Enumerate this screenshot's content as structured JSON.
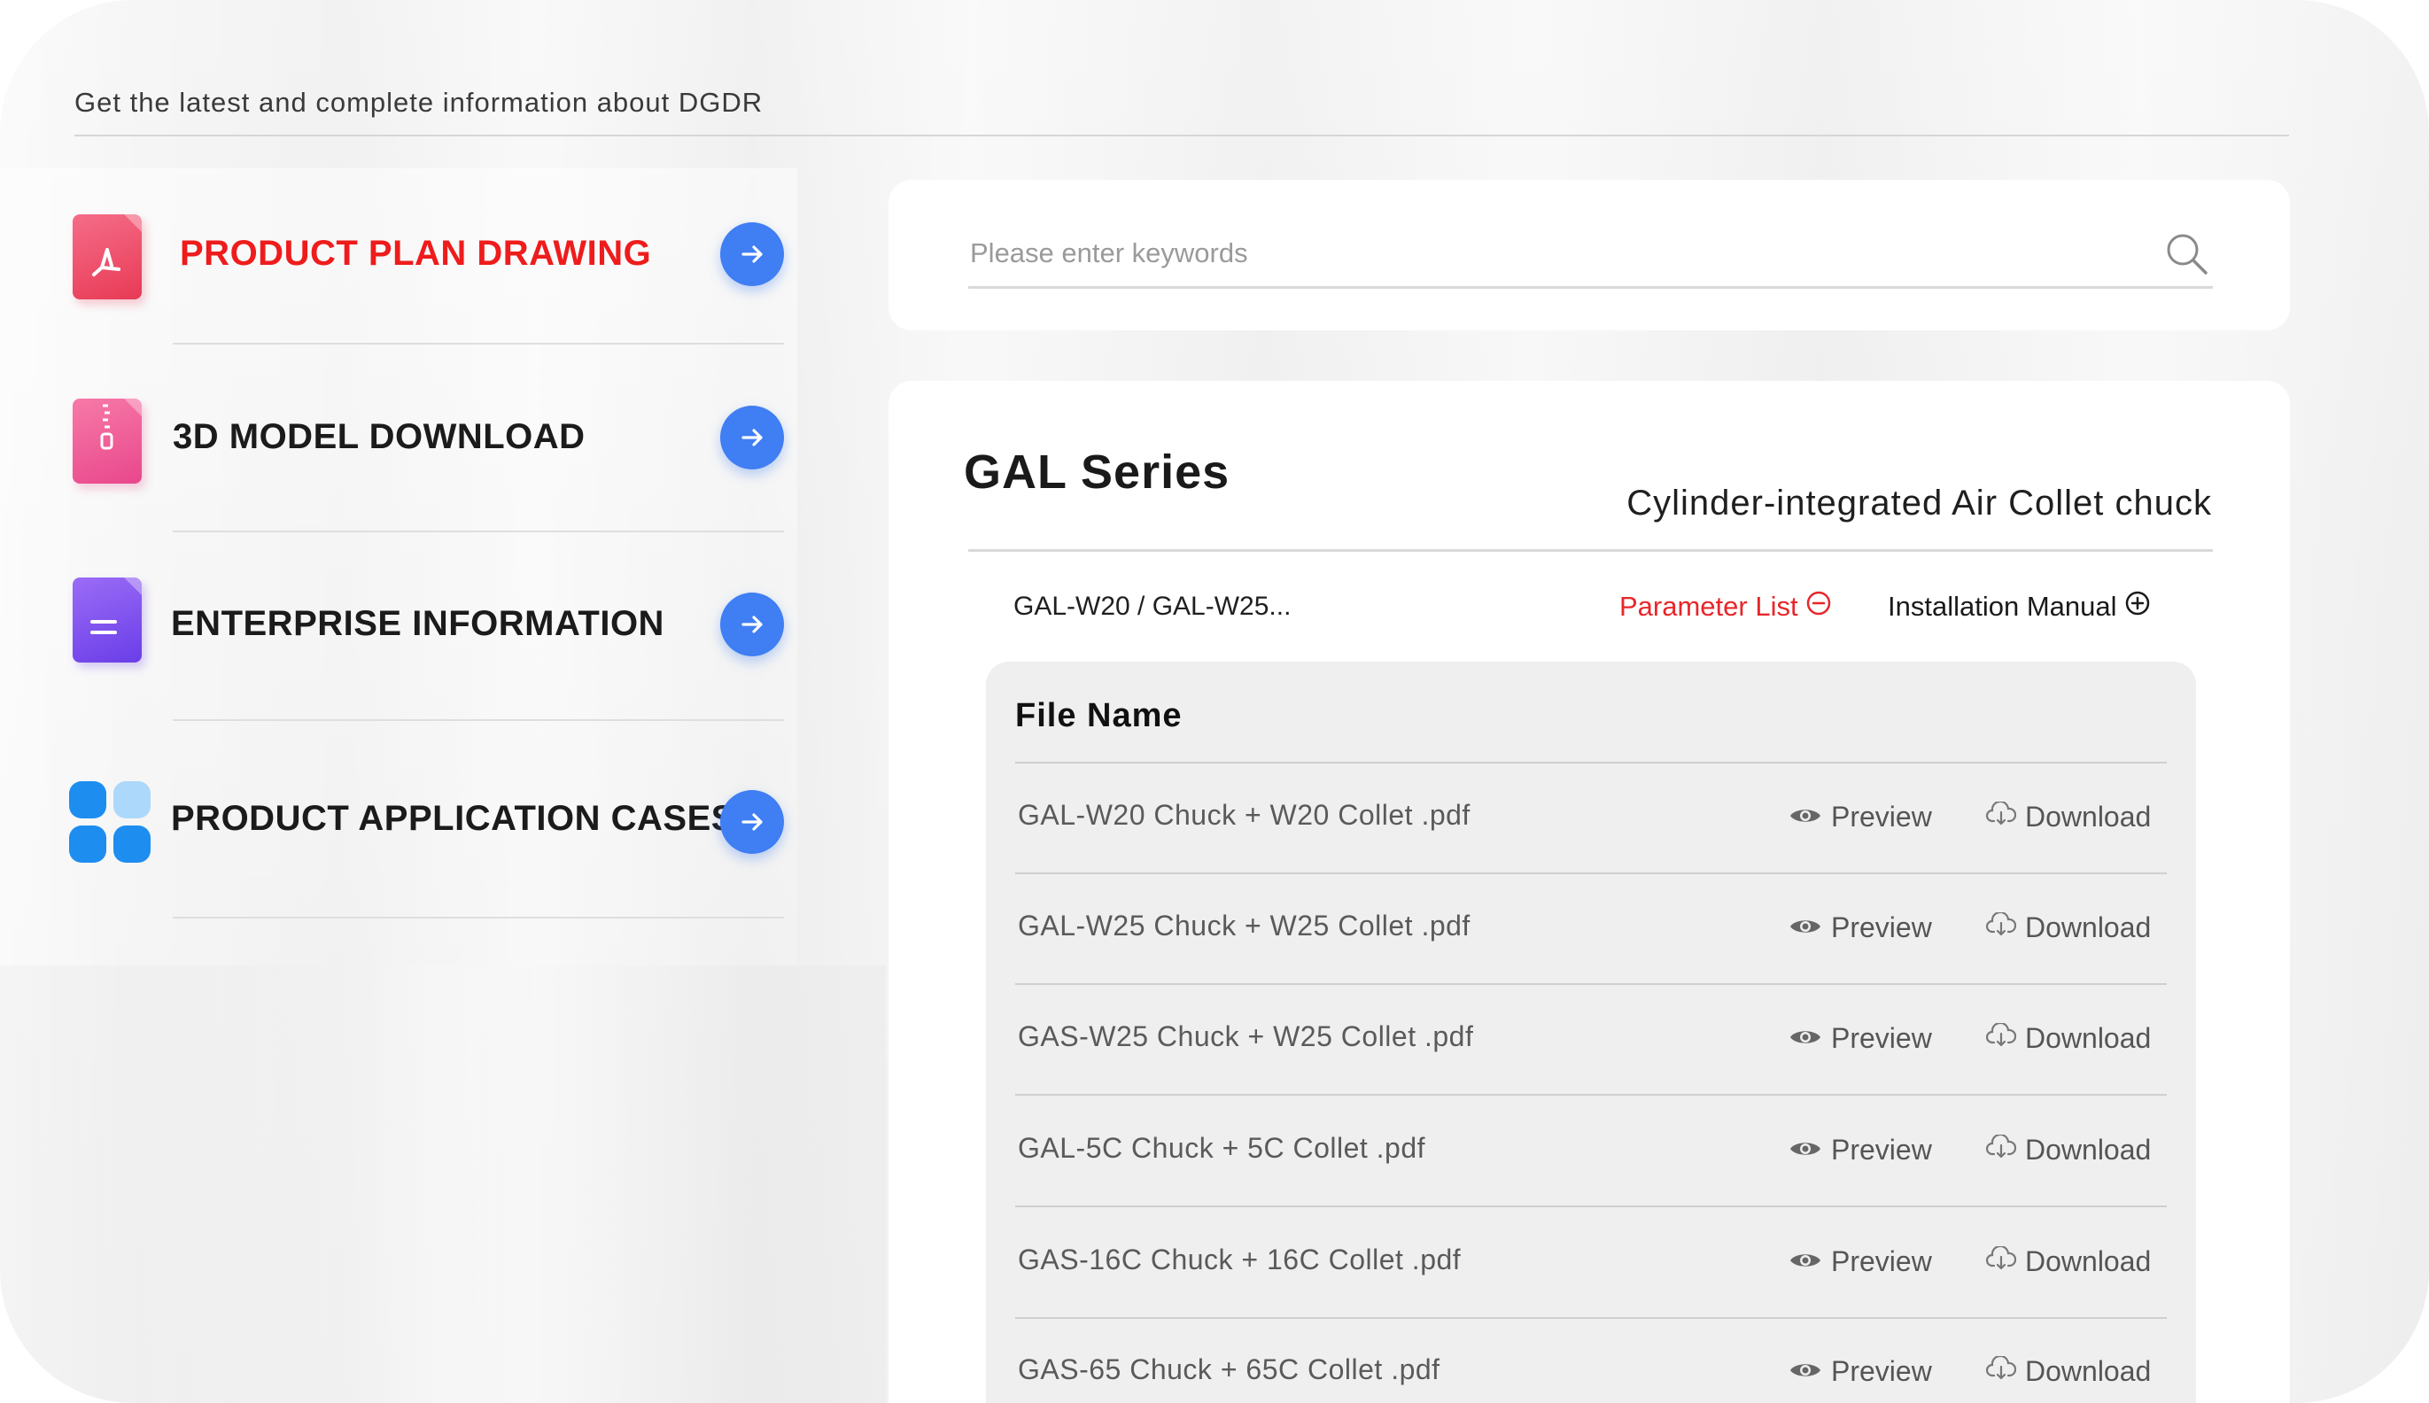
{
  "header": {
    "tagline": "Get the latest and complete information about DGDR"
  },
  "sidebar": {
    "items": [
      {
        "label": "PRODUCT PLAN DRAWING",
        "icon": "pdf-icon",
        "active": true
      },
      {
        "label": "3D MODEL DOWNLOAD",
        "icon": "zip-file-icon",
        "active": false
      },
      {
        "label": "ENTERPRISE INFORMATION",
        "icon": "document-icon",
        "active": false
      },
      {
        "label": "PRODUCT APPLICATION CASES",
        "icon": "app-grid-icon",
        "active": false
      }
    ],
    "arrow_icon": "arrow-right-icon"
  },
  "search": {
    "placeholder": "Please enter keywords",
    "icon": "search-icon"
  },
  "series": {
    "title": "GAL Series",
    "subtitle": "Cylinder-integrated Air Collet chuck",
    "models": "GAL-W20 / GAL-W25...",
    "parameter_list_label": "Parameter List",
    "installation_manual_label": "Installation Manual"
  },
  "files": {
    "header": "File Name",
    "preview_label": "Preview",
    "download_label": "Download",
    "rows": [
      {
        "name": "GAL-W20 Chuck + W20 Collet .pdf"
      },
      {
        "name": "GAL-W25 Chuck + W25 Collet .pdf"
      },
      {
        "name": "GAS-W25 Chuck + W25 Collet .pdf"
      },
      {
        "name": "GAL-5C Chuck + 5C Collet .pdf"
      },
      {
        "name": "GAS-16C Chuck + 16C Collet .pdf"
      },
      {
        "name": "GAS-65 Chuck + 65C Collet .pdf"
      }
    ]
  },
  "colors": {
    "accent_blue": "#3f7ef3",
    "active_red": "#ee1c1c",
    "link_red": "#e8262a"
  }
}
